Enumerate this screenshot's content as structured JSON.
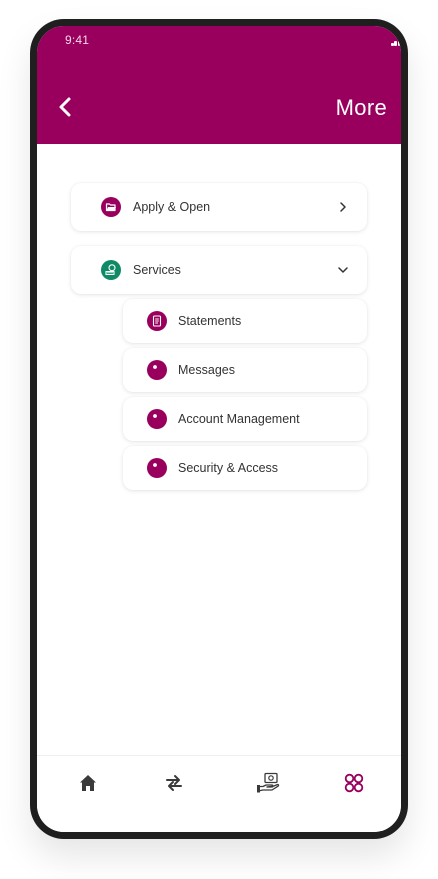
{
  "status_bar": {
    "time": "9:41"
  },
  "header": {
    "title": "More",
    "back_icon": "chevron-left-icon"
  },
  "menu": {
    "apply_open": {
      "label": "Apply & Open",
      "icon": "folder-open-icon",
      "icon_color": "#99005e",
      "state": "collapsed"
    },
    "services": {
      "label": "Services",
      "icon": "coins-icon",
      "icon_color": "#0e8a66",
      "state": "expanded",
      "items": [
        {
          "label": "Statements",
          "icon": "document-icon"
        },
        {
          "label": "Messages",
          "icon": "dot-icon"
        },
        {
          "label": "Account Management",
          "icon": "dot-icon"
        },
        {
          "label": "Security & Access",
          "icon": "dot-icon"
        }
      ]
    }
  },
  "bottom_nav": {
    "items": [
      {
        "name": "home",
        "icon": "home-icon",
        "active": false
      },
      {
        "name": "transfers",
        "icon": "swap-arrows-icon",
        "active": false
      },
      {
        "name": "payments",
        "icon": "hand-money-icon",
        "active": false
      },
      {
        "name": "more",
        "icon": "grid-icon",
        "active": true
      }
    ]
  },
  "colors": {
    "brand": "#99005e",
    "services_icon": "#0e8a66",
    "inactive_icon": "#3a3a3a"
  }
}
